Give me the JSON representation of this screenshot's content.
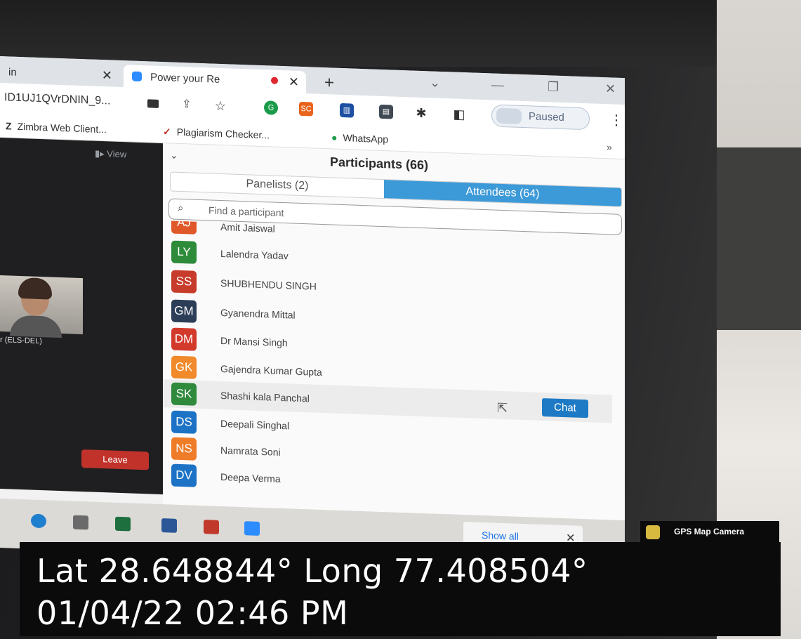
{
  "browser": {
    "left_tab_label": "in",
    "active_tab_label": "Power your Re",
    "url_text": "ID1UJ1QVrDNIN_9...",
    "paused_label": "Paused",
    "bookmarks": [
      {
        "label": "Zimbra Web Client...",
        "icon": "zimbra-icon",
        "glyph": "Z"
      },
      {
        "label": "Plagiarism Checker...",
        "icon": "checkmark-icon",
        "glyph": "✓"
      },
      {
        "label": "WhatsApp",
        "icon": "whatsapp-icon",
        "glyph": "●"
      }
    ],
    "more_bookmarks_glyph": "»"
  },
  "meeting": {
    "view_label": "View",
    "thumbnail_label": "r (ELS-DEL)",
    "leave_label": "Leave"
  },
  "participants": {
    "title": "Participants (66)",
    "panelists_tab": "Panelists (2)",
    "attendees_tab": "Attendees (64)",
    "search_placeholder": "Find a participant",
    "list": [
      {
        "initials": "AJ",
        "name": "Amit Jaiswal",
        "color": "#e0582a"
      },
      {
        "initials": "LY",
        "name": "Lalendra Yadav",
        "color": "#2e8b3a"
      },
      {
        "initials": "SS",
        "name": "SHUBHENDU SINGH",
        "color": "#c73b2b"
      },
      {
        "initials": "GM",
        "name": "Gyanendra Mittal",
        "color": "#2c3e57"
      },
      {
        "initials": "DM",
        "name": "Dr Mansi Singh",
        "color": "#d23a2c"
      },
      {
        "initials": "GK",
        "name": "Gajendra Kumar Gupta",
        "color": "#f08a2a"
      },
      {
        "initials": "SK",
        "name": "Shashi kala Panchal",
        "color": "#2f8a3c"
      },
      {
        "initials": "DS",
        "name": "Deepali Singhal",
        "color": "#1c73c6"
      },
      {
        "initials": "NS",
        "name": "Namrata Soni",
        "color": "#ee7c28"
      },
      {
        "initials": "DV",
        "name": "Deepa Verma",
        "color": "#1c73c6"
      }
    ],
    "chat_label": "Chat"
  },
  "notification": {
    "show_all_label": "Show all"
  },
  "overlay": {
    "badge_label": "GPS Map Camera",
    "coords": "Lat 28.648844° Long 77.408504°",
    "datetime": "01/04/22 02:46 PM"
  }
}
